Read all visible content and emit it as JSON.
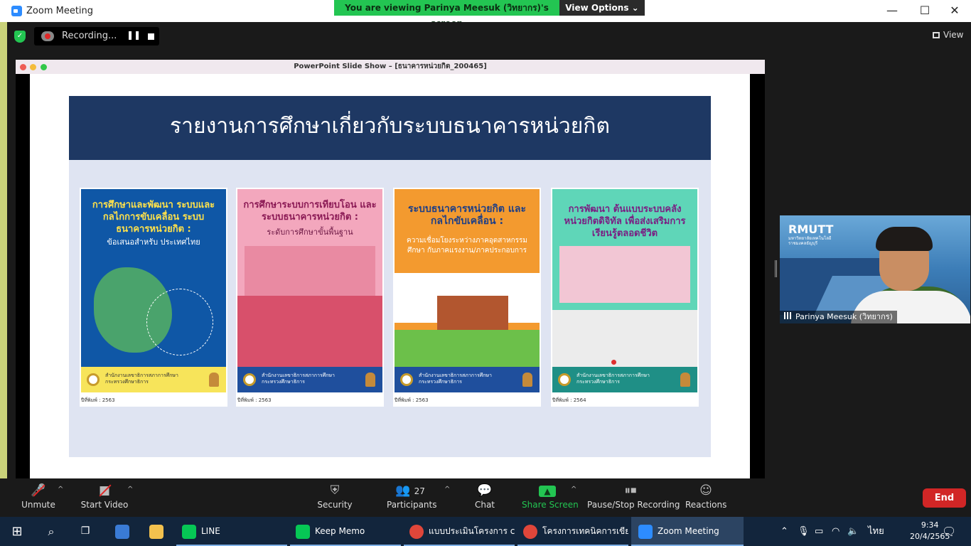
{
  "window": {
    "title": "Zoom Meeting",
    "minimize": "—",
    "maximize": "☐",
    "close": "✕"
  },
  "banner": {
    "viewing_text": "You are viewing Parinya Meesuk (วิทยากร)'s screen",
    "view_options_label": "View Options ⌄"
  },
  "recording": {
    "label": "Recording...",
    "pause": "❚❚"
  },
  "view_label": "View",
  "slideshow": {
    "window_title": "PowerPoint Slide Show – [ธนาคารหน่วยกิต_200465]",
    "slide_title": "รายงานการศึกษาเกี่ยวกับระบบธนาคารหน่วยกิต",
    "reports": [
      {
        "title": "การศึกษาและพัฒนา ระบบและกลไกการขับเคลื่อน ระบบธนาคารหน่วยกิต :",
        "subtitle": "ข้อเสนอสำหรับ ประเทศไทย",
        "publisher": "สำนักงานเลขาธิการสภาการศึกษา กระทรวงศึกษาธิการ",
        "year": "ปีที่พิมพ์ : 2563",
        "theme_bg": "#0f57a6",
        "title_color": "#ffe14a",
        "subtitle_color": "#ffffff",
        "footer_bg": "#f7e45a"
      },
      {
        "title": "การศึกษาระบบการเทียบโอน และระบบธนาคารหน่วยกิต :",
        "subtitle": "ระดับการศึกษาขั้นพื้นฐาน",
        "publisher": "สำนักงานเลขาธิการสภาการศึกษา กระทรวงศึกษาธิการ",
        "year": "ปีที่พิมพ์ : 2563",
        "theme_bg": "#f3a7bd",
        "title_color": "#8b1a55",
        "subtitle_color": "#6d1845",
        "footer_bg": "#1f4f9d"
      },
      {
        "title": "ระบบธนาคารหน่วยกิต และกลไกขับเคลื่อน :",
        "subtitle": "ความเชื่อมโยงระหว่างภาคอุตสาหกรรมศึกษา กับภาคแรงงาน/ภาคประกอบการ",
        "publisher": "สำนักงานเลขาธิการสภาการศึกษา กระทรวงศึกษาธิการ",
        "year": "ปีที่พิมพ์ : 2563",
        "theme_bg": "#f39a2f",
        "title_color": "#1e3f86",
        "subtitle_color": "#ffffff",
        "footer_bg": "#1f4f9d"
      },
      {
        "title": "การพัฒนา ต้นแบบระบบคลังหน่วยกิตดิจิทัล เพื่อส่งเสริมการเรียนรู้ตลอดชีวิต",
        "subtitle": "",
        "publisher": "สำนักงานเลขาธิการสภาการศึกษา กระทรวงศึกษาธิการ",
        "year": "ปีที่พิมพ์ : 2564",
        "theme_bg": "#5fd6b8",
        "title_color": "#7a1f83",
        "subtitle_color": "#7a1f83",
        "footer_bg": "#1f8f86"
      }
    ]
  },
  "participant": {
    "name": "Parinya Meesuk (วิทยากร)",
    "logo_text": "RMUTT",
    "logo_sub": "มหาวิทยาลัยเทคโนโลยีราชมงคลธัญบุรี"
  },
  "toolbar": {
    "unmute": "Unmute",
    "start_video": "Start Video",
    "security": "Security",
    "participants": "Participants",
    "participant_count": "27",
    "chat": "Chat",
    "share_screen": "Share Screen",
    "pause_stop_recording": "Pause/Stop Recording",
    "reactions": "Reactions",
    "end": "End"
  },
  "taskbar": {
    "apps": [
      {
        "label": "LINE",
        "color": "#06c755"
      },
      {
        "label": "Keep Memo",
        "color": "#06c755"
      },
      {
        "label": "แบบประเมินโครงการ cr...",
        "color": "#e0463a"
      },
      {
        "label": "โครงการเทคนิคการเขีย...",
        "color": "#e0463a"
      },
      {
        "label": "Zoom Meeting",
        "color": "#2d8cff"
      }
    ],
    "language": "ไทย",
    "time": "9:34",
    "date": "20/4/2565"
  },
  "colors": {
    "zoom_blue": "#2d8cff",
    "share_green": "#23c552",
    "end_red": "#d12626",
    "slide_banner": "#1e3863"
  }
}
